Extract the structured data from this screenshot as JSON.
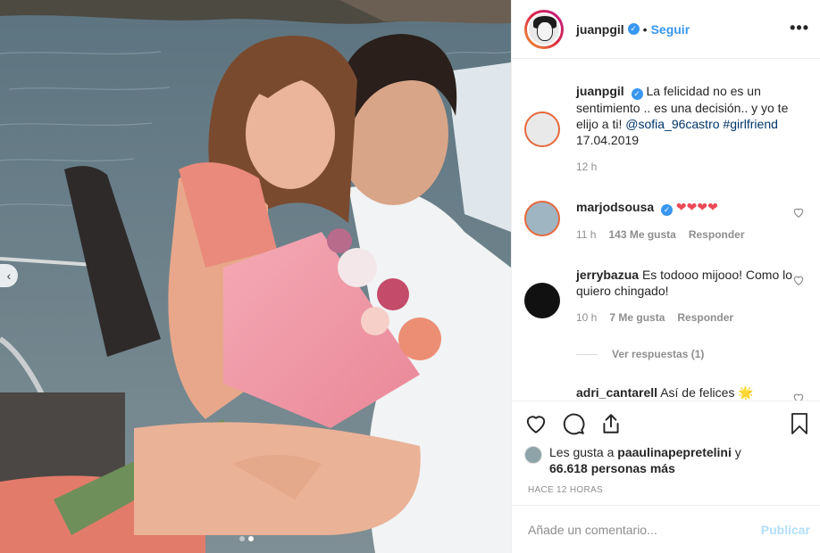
{
  "post": {
    "username": "juanpgil",
    "follow_label": "Seguir",
    "separator": "•",
    "more_label": "•••"
  },
  "caption": {
    "username": "juanpgil",
    "text": "La felicidad no es un sentimiento .. es una decisión.. y yo te elijo a ti!",
    "mention": "@sofia_96castro",
    "hashtag": "#girlfriend",
    "date": "17.04.2019",
    "time": "12 h"
  },
  "comments": [
    {
      "username": "marjodsousa",
      "text": "❤❤❤❤",
      "time": "11 h",
      "likes": "143 Me gusta",
      "reply_label": "Responder"
    },
    {
      "username": "jerrybazua",
      "text": "Es todooo mijooo! Como lo quiero chingado!",
      "time": "10 h",
      "likes": "7 Me gusta",
      "reply_label": "Responder",
      "view_replies": "Ver respuestas (1)"
    },
    {
      "username": "adri_cantarell",
      "text": "Así de felices 🌟"
    }
  ],
  "likes": {
    "prefix": "Les gusta a",
    "user": "paaulinapepretelini",
    "connector": "y",
    "count": "66.618 personas más"
  },
  "time_ago": "HACE 12 HORAS",
  "add_comment": {
    "placeholder": "Añade un comentario...",
    "post_label": "Publicar"
  },
  "carousel": {
    "current": 2,
    "total": 2
  },
  "colors": {
    "accent": "#3897f0",
    "link": "#003569",
    "muted": "#8e8e8e",
    "heart_red": "#ed4956",
    "publish_disabled": "#b2dffc"
  },
  "icons": [
    "verified-icon",
    "more-options-icon",
    "like-heart-icon",
    "comment-icon",
    "share-icon",
    "save-bookmark-icon",
    "carousel-prev-icon",
    "comment-like-icon"
  ]
}
